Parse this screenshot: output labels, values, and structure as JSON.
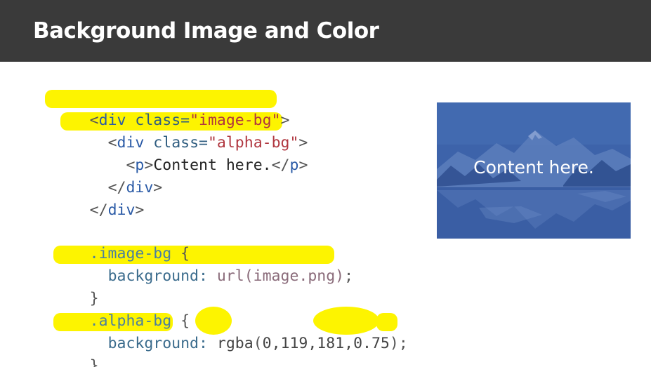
{
  "slide": {
    "title": "Background Image and Color"
  },
  "code": {
    "l1": {
      "open": "<",
      "tag": "div",
      "attr": " class=",
      "val": "\"image-bg\"",
      "close": ">"
    },
    "l2": {
      "indent": "  ",
      "open": "<",
      "tag": "div",
      "attr": " class=",
      "val": "\"alpha-bg\"",
      "close": ">"
    },
    "l3": {
      "indent": "    ",
      "open": "<",
      "tag": "p",
      "mid": ">",
      "text": "Content here.",
      "close_open": "</",
      "close_tag": "p",
      "close": ">"
    },
    "l4": {
      "indent": "  ",
      "open": "</",
      "tag": "div",
      "close": ">"
    },
    "l5": {
      "open": "</",
      "tag": "div",
      "close": ">"
    },
    "l7": {
      "selector": ".image-bg",
      "brace": " {"
    },
    "l8": {
      "indent": "  ",
      "prop": "background:",
      "value": " url(image.png)",
      "semi": ";"
    },
    "l9": {
      "brace": "}"
    },
    "l10": {
      "selector": ".alpha-bg",
      "brace": " {"
    },
    "l11": {
      "indent": "  ",
      "prop": "background:",
      "fn": " rgba",
      "paren_open": "(",
      "args": "0,119,181,",
      "alpha": "0.75",
      "paren_close": ")",
      "semi": ";"
    },
    "l12": {
      "brace": "}"
    }
  },
  "preview": {
    "text": "Content here.",
    "overlay_color": "rgba(0,119,181,0.75)"
  },
  "colors": {
    "title_bar": "#3a3a3a",
    "highlight": "#fdf400",
    "preview_blue": "#3d64ab"
  }
}
